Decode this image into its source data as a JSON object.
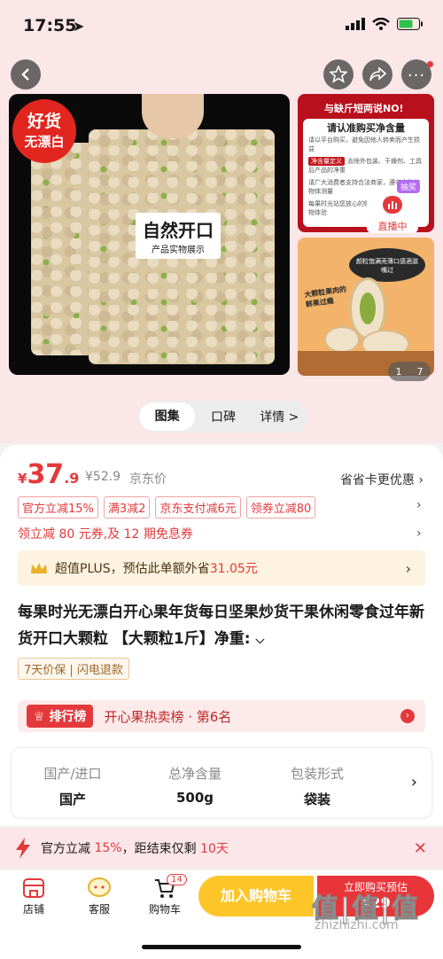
{
  "status": {
    "time": "17:55"
  },
  "gallery": {
    "badge_line1": "好货",
    "badge_line2": "无漂白",
    "overlay_title": "自然开口",
    "overlay_sub": "产品实物展示",
    "thumb1_header": "与缺斤短两说NO!",
    "thumb1_title": "请认准购买净含量",
    "thumb1_note": "请以平台购买，避免因他人转卖而产生损益",
    "thumb1_tag": "净含量定义",
    "thumb1_tag_text": "去除外包装、干燥剂、工具后产品的净重",
    "thumb1_line": "请广大消费者支持合法商家，遵守合法的物体测量",
    "thumb1_line2": "每果时光站您放心的购物体验",
    "live_badge": "抽奖",
    "live_label": "直播中",
    "thumb2_bubble": "颜粒饱满壳薄口感酒滋嘴过",
    "thumb2_text": "大颗粒果肉的鲜果过瘾",
    "pager_current": "1",
    "pager_total": "7"
  },
  "tabs": [
    "图集",
    "口碑",
    "详情 >"
  ],
  "price": {
    "yen": "¥",
    "int": "37",
    "dec": ".9",
    "original": "¥52.9",
    "jd_label": "京东价",
    "card_offer": "省省卡更优惠"
  },
  "coupons": [
    "官方立减15%",
    "满3减2",
    "京东支付减6元",
    "领券立减80"
  ],
  "coupon_line": "领立减 80 元券,及 12 期免息券",
  "plus": {
    "text": "超值PLUS，预估此单额外省",
    "amount": "31.05元"
  },
  "product_title": "每果时光无漂白开心果年货每日坚果炒货干果休闲零食过年新货开口大颗粒 【大颗粒1斤】净重:",
  "service": "7天价保 | 闪电退款",
  "rank": {
    "tag": "排行榜",
    "text": "开心果热卖榜 · 第6名"
  },
  "specs": [
    {
      "k": "国产/进口",
      "v": "国产"
    },
    {
      "k": "总净含量",
      "v": "500g"
    },
    {
      "k": "包装形式",
      "v": "袋装"
    }
  ],
  "promo": {
    "pre": "官方立减",
    "pct": "15%",
    "mid": "，距结束仅剩",
    "days": "10天"
  },
  "bottom": {
    "store": "店铺",
    "service": "客服",
    "cart": "购物车",
    "cart_count": "14",
    "add_cart": "加入购物车",
    "buy_now": "立即购买预估",
    "buy_price": "¥29"
  },
  "watermark": {
    "logo": "值|值|值",
    "url": "zhizhizhi.com"
  }
}
